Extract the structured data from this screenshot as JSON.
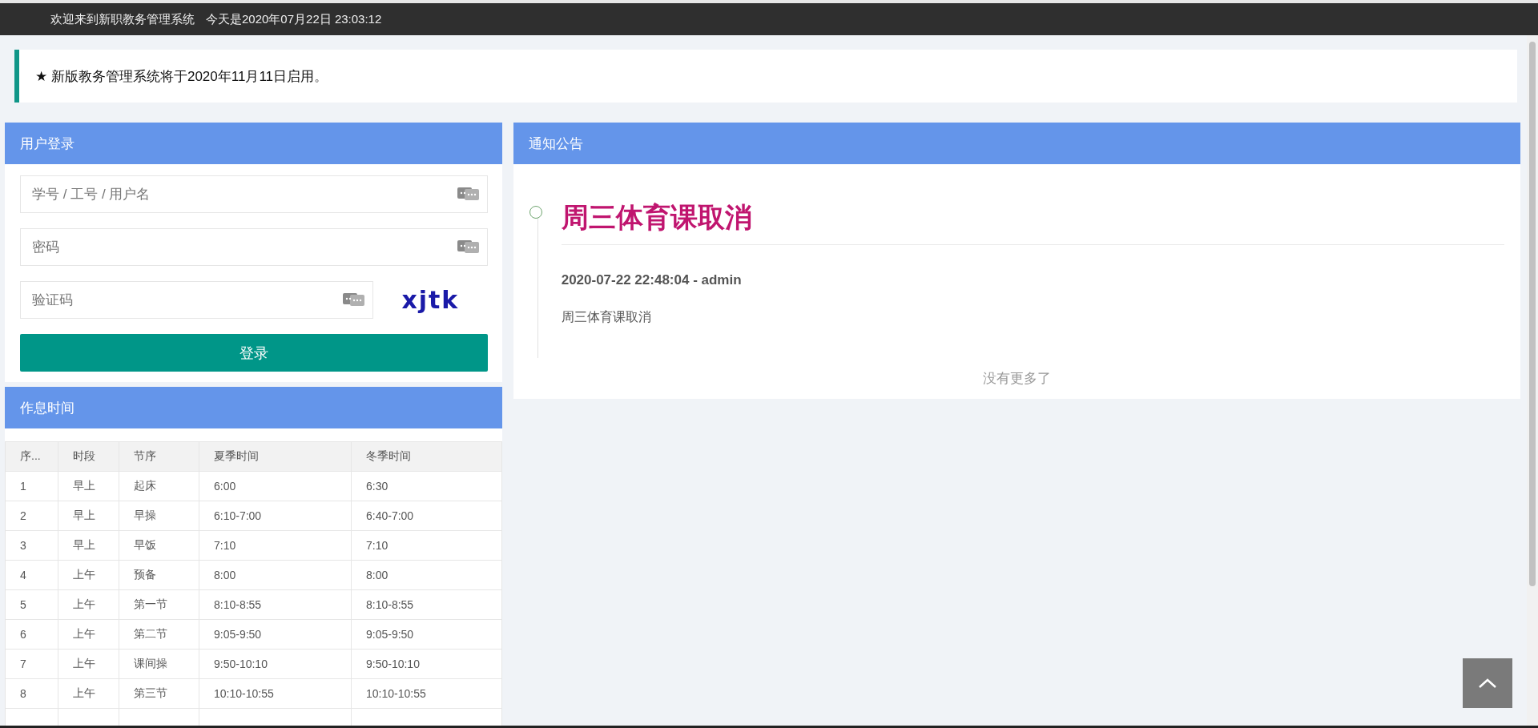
{
  "top_bar": {
    "welcome": "欢迎来到新职教务管理系统",
    "date_time": "今天是2020年07月22日 23:03:12"
  },
  "announcement_banner": {
    "text": "★ 新版教务管理系统将于2020年11月11日启用。"
  },
  "login_panel": {
    "title": "用户登录",
    "fields": [
      {
        "placeholder": "学号 / 工号 / 用户名"
      },
      {
        "placeholder": "密码"
      }
    ],
    "captcha_field": {
      "placeholder": "验证码"
    },
    "captcha_text": "xjtk",
    "submit_button": "登录"
  },
  "schedule_panel": {
    "title": "作息时间",
    "columns": [
      "序...",
      "时段",
      "节序",
      "夏季时间",
      "冬季时间"
    ],
    "rows": [
      [
        "1",
        "早上",
        "起床",
        "6:00",
        "6:30"
      ],
      [
        "2",
        "早上",
        "早操",
        "6:10-7:00",
        "6:40-7:00"
      ],
      [
        "3",
        "早上",
        "早饭",
        "7:10",
        "7:10"
      ],
      [
        "4",
        "上午",
        "预备",
        "8:00",
        "8:00"
      ],
      [
        "5",
        "上午",
        "第一节",
        "8:10-8:55",
        "8:10-8:55"
      ],
      [
        "6",
        "上午",
        "第二节",
        "9:05-9:50",
        "9:05-9:50"
      ],
      [
        "7",
        "上午",
        "课间操",
        "9:50-10:10",
        "9:50-10:10"
      ],
      [
        "8",
        "上午",
        "第三节",
        "10:10-10:55",
        "10:10-10:55"
      ]
    ]
  },
  "notice_panel": {
    "title": "通知公告",
    "items": [
      {
        "title": "周三体育课取消",
        "meta": "2020-07-22 22:48:04 - admin",
        "body": "周三体育课取消"
      }
    ],
    "footer": "没有更多了"
  }
}
